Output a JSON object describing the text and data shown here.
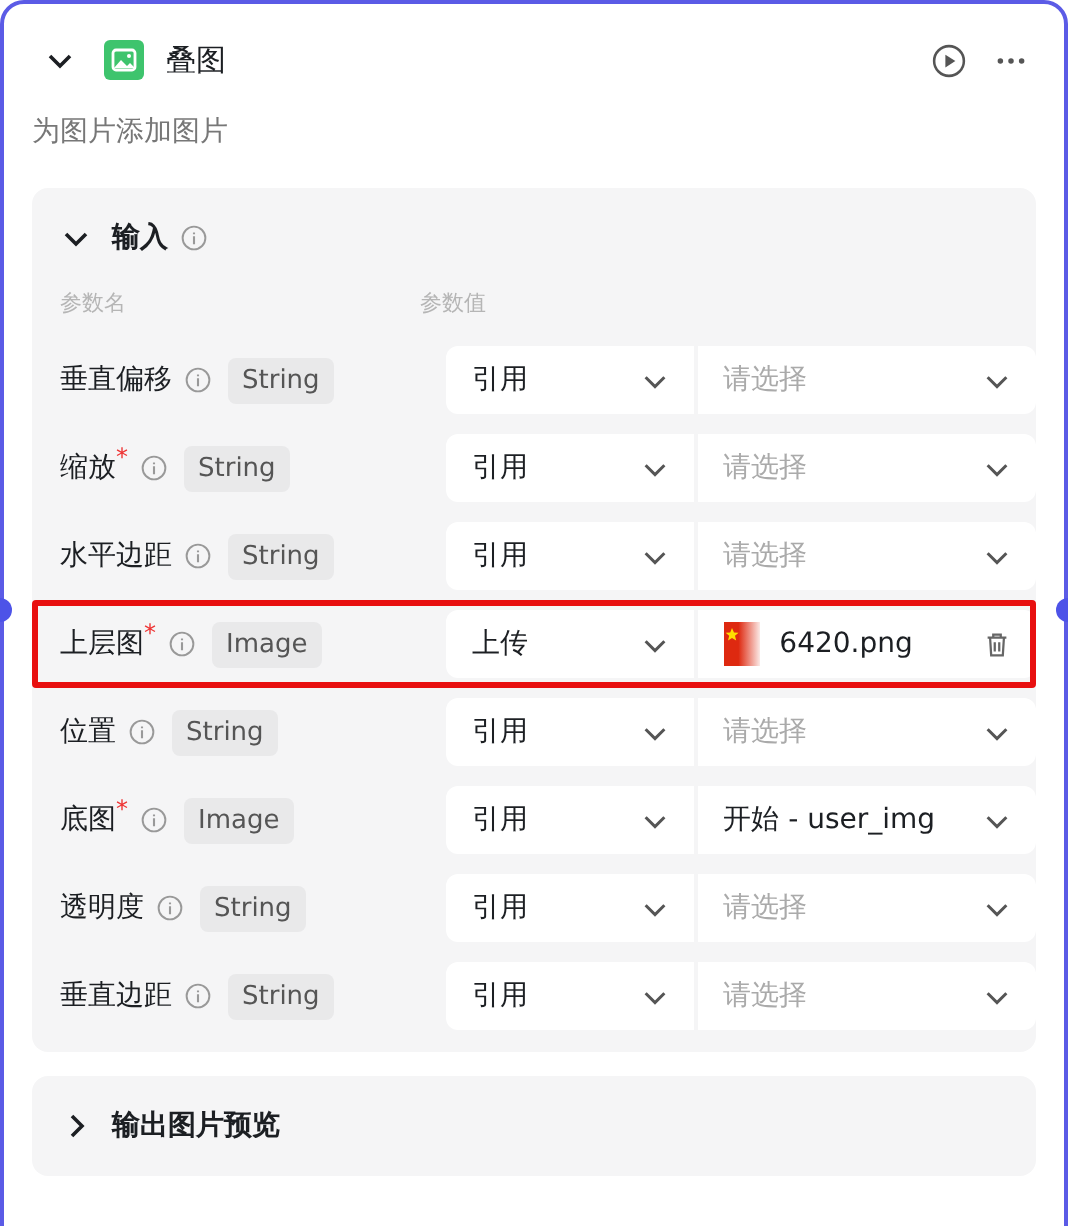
{
  "node": {
    "title": "叠图",
    "description": "为图片添加图片",
    "expanded": true
  },
  "input": {
    "title": "输入",
    "expanded": true,
    "columns": [
      "参数名",
      "参数值"
    ],
    "rows": [
      {
        "name": "垂直偏移",
        "type": "String",
        "mode": "引用",
        "kind": "empty",
        "placeholder": "请选择",
        "highlighted": false
      },
      {
        "name": "缩放$^{*}$",
        "type": "String",
        "mode": "引用",
        "kind": "empty",
        "placeholder": "请选择",
        "highlighted": false
      },
      {
        "name": "水平边距",
        "type": "String",
        "mode": "引用",
        "kind": "empty",
        "placeholder": "请选择",
        "highlighted": false
      },
      {
        "name": "上层图$^{*}$",
        "type": "Image",
        "mode": "上传",
        "kind": "file",
        "value": "6420.png",
        "highlighted": true
      },
      {
        "name": "位置",
        "type": "String",
        "mode": "引用",
        "kind": "empty",
        "placeholder": "请选择",
        "highlighted": false
      },
      {
        "name": "底图$^{*}$",
        "type": "Image",
        "mode": "引用",
        "kind": "reference",
        "value": "开始 - user_img",
        "highlighted": false
      },
      {
        "name": "透明度",
        "type": "String",
        "mode": "引用",
        "kind": "empty",
        "placeholder": "请选择",
        "highlighted": false
      },
      {
        "name": "垂直边距",
        "type": "String",
        "mode": "引用",
        "kind": "empty",
        "placeholder": "请选择",
        "highlighted": false
      }
    ]
  },
  "output": {
    "title": "输出图片预览",
    "expanded": false
  }
}
